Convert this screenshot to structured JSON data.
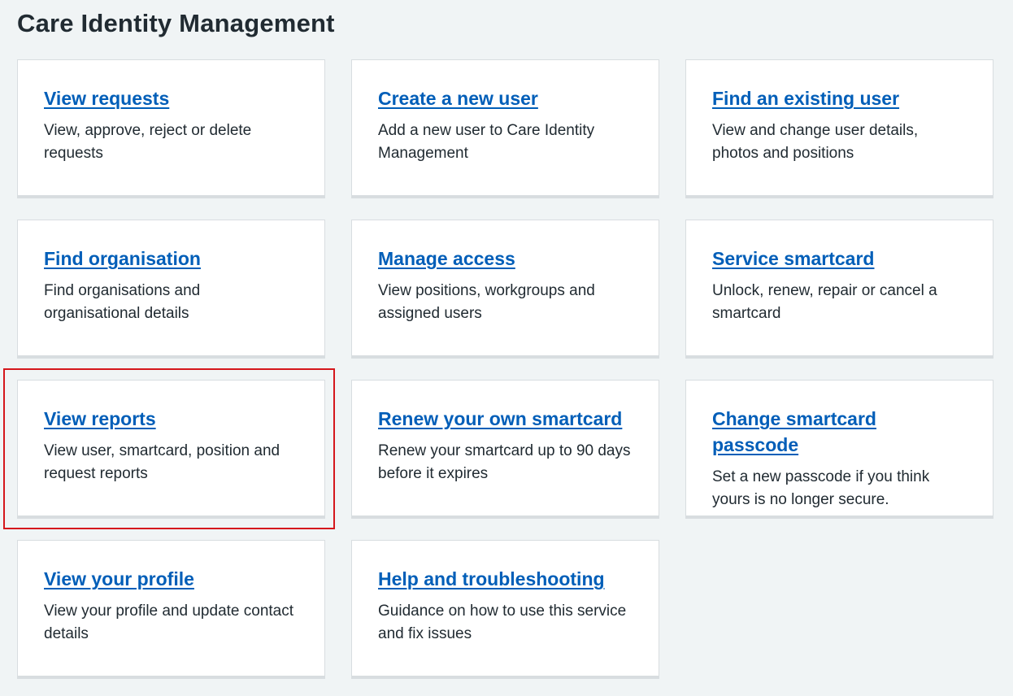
{
  "page": {
    "title": "Care Identity Management"
  },
  "colors": {
    "background": "#f0f4f5",
    "card": "#ffffff",
    "link": "#005eb8",
    "text": "#212b32",
    "highlight": "#d5171c"
  },
  "cards": [
    {
      "title": "View requests",
      "description": "View, approve, reject or delete requests"
    },
    {
      "title": "Create a new user",
      "description": "Add a new user to Care Identity Management"
    },
    {
      "title": "Find an existing user",
      "description": "View and change user details, photos and positions"
    },
    {
      "title": "Find organisation",
      "description": "Find organisations and organisational details"
    },
    {
      "title": "Manage access",
      "description": "View positions, workgroups and assigned users"
    },
    {
      "title": "Service smartcard",
      "description": "Unlock, renew, repair or cancel a smartcard"
    },
    {
      "title": "View reports",
      "description": "View user, smartcard, position and request reports"
    },
    {
      "title": "Renew your own smartcard",
      "description": "Renew your smartcard up to 90 days before it expires"
    },
    {
      "title": "Change smartcard passcode",
      "description": "Set a new passcode if you think yours is no longer secure."
    },
    {
      "title": "View your profile",
      "description": "View your profile and update contact details"
    },
    {
      "title": "Help and troubleshooting",
      "description": "Guidance on how to use this service and fix issues"
    }
  ]
}
